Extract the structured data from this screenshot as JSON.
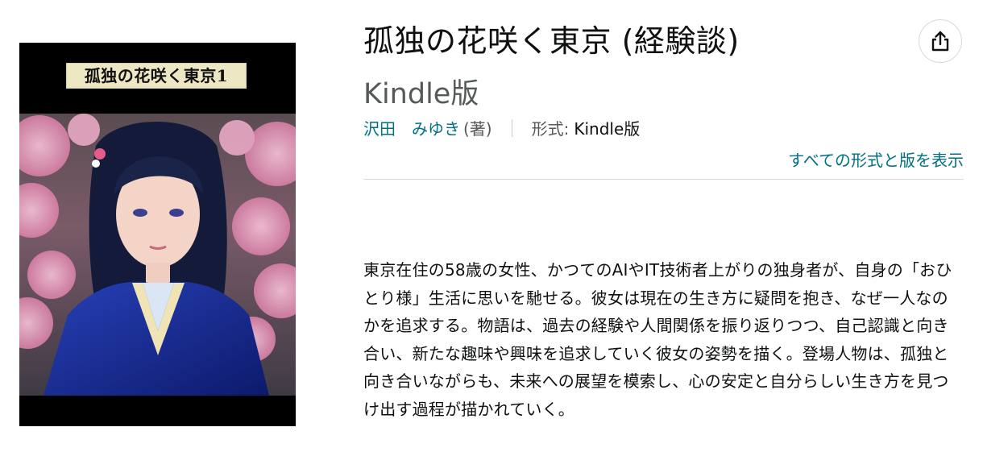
{
  "book": {
    "cover_title": "孤独の花咲く東京1",
    "title": "孤独の花咲く東京 (経験談)",
    "format_subtitle": "Kindle版",
    "author_name": "沢田　みゆき",
    "author_role": "(著)",
    "format_label": "形式:",
    "format_value": "Kindle版",
    "all_formats_link": "すべての形式と版を表示",
    "description": "東京在住の58歳の女性、かつてのAIやIT技術者上がりの独身者が、自身の「おひとり様」生活に思いを馳せる。彼女は現在の生き方に疑問を抱き、なぜ一人なのかを追求する。物語は、過去の経験や人間関係を振り返りつつ、自己認識と向き合い、新たな趣味や興味を追求していく彼女の姿勢を描く。登場人物は、孤独と向き合いながらも、未来への展望を模索し、心の安定と自分らしい生き方を見つけ出す過程が描かれていく。"
  },
  "icons": {
    "share": "share-icon"
  },
  "colors": {
    "link": "#007185",
    "secondary": "#565959",
    "divider": "#d5d9d9"
  }
}
